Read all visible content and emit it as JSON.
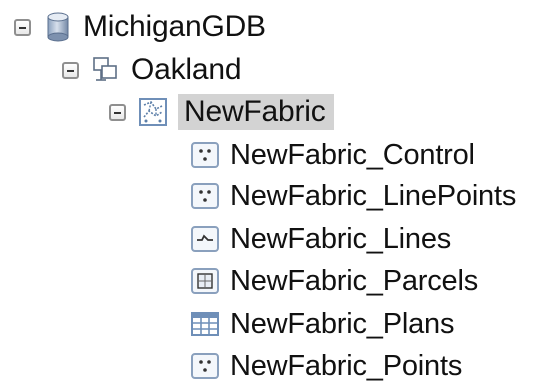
{
  "tree": {
    "database": {
      "label": "MichiganGDB",
      "icon": "geodatabase-cylinder-icon"
    },
    "dataset": {
      "label": "Oakland",
      "icon": "feature-dataset-icon"
    },
    "fabric": {
      "label": "NewFabric",
      "icon": "parcel-fabric-icon",
      "selected": true
    },
    "children": [
      {
        "label": "NewFabric_Control",
        "icon": "point-feature-class-icon"
      },
      {
        "label": "NewFabric_LinePoints",
        "icon": "point-feature-class-icon"
      },
      {
        "label": "NewFabric_Lines",
        "icon": "line-feature-class-icon"
      },
      {
        "label": "NewFabric_Parcels",
        "icon": "polygon-feature-class-icon"
      },
      {
        "label": "NewFabric_Plans",
        "icon": "table-icon"
      },
      {
        "label": "NewFabric_Points",
        "icon": "point-feature-class-icon"
      }
    ]
  },
  "colors": {
    "selection": "#d3d3d3",
    "icon_blue": "#5b7ea8",
    "icon_border": "#6f8fb8"
  }
}
